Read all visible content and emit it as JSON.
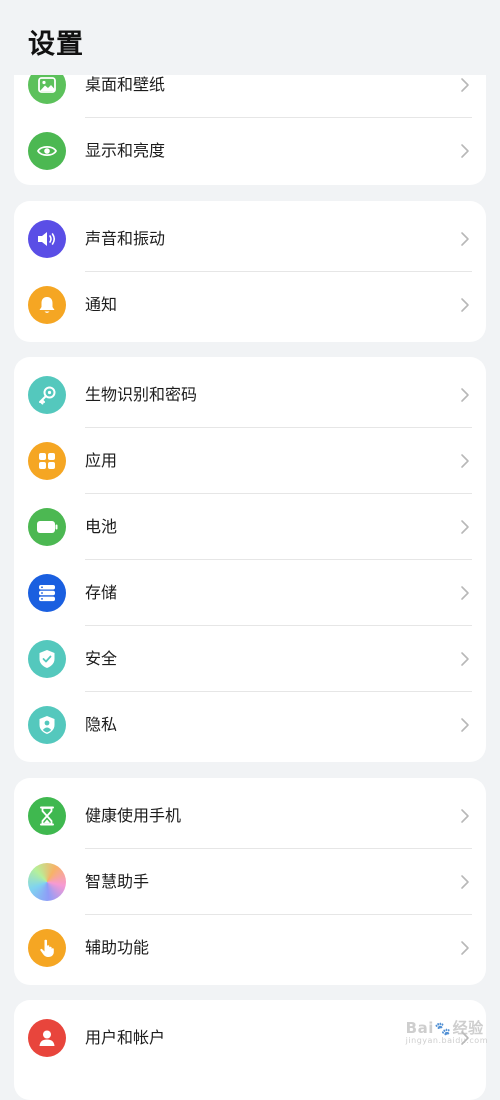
{
  "header": {
    "title": "设置",
    "status_fragment": "·· ··"
  },
  "cards": [
    {
      "items": [
        {
          "label": "桌面和壁纸",
          "icon": "wallpaper-icon",
          "color": "#5cc15b"
        },
        {
          "label": "显示和亮度",
          "icon": "eye-icon",
          "color": "#4cb852"
        }
      ]
    },
    {
      "items": [
        {
          "label": "声音和振动",
          "icon": "speaker-icon",
          "color": "#5a4ee6"
        },
        {
          "label": "通知",
          "icon": "bell-icon",
          "color": "#f5a623"
        }
      ]
    },
    {
      "items": [
        {
          "label": "生物识别和密码",
          "icon": "key-icon",
          "color": "#54c8bd"
        },
        {
          "label": "应用",
          "icon": "apps-icon",
          "color": "#f5a623"
        },
        {
          "label": "电池",
          "icon": "battery-icon",
          "color": "#4cb852"
        },
        {
          "label": "存储",
          "icon": "storage-icon",
          "color": "#1a5fe0"
        },
        {
          "label": "安全",
          "icon": "shield-check-icon",
          "color": "#54c8bd"
        },
        {
          "label": "隐私",
          "icon": "privacy-shield-icon",
          "color": "#54c8bd"
        }
      ]
    },
    {
      "items": [
        {
          "label": "健康使用手机",
          "icon": "hourglass-icon",
          "color": "#3fb84f"
        },
        {
          "label": "智慧助手",
          "icon": "assistant-orb-icon",
          "color": "#c88ad8"
        },
        {
          "label": "辅助功能",
          "icon": "hand-pointer-icon",
          "color": "#f5a623"
        }
      ]
    },
    {
      "items": [
        {
          "label": "用户和帐户",
          "icon": "user-icon",
          "color": "#e8453c"
        }
      ]
    }
  ],
  "watermark": {
    "text_left": "Bai",
    "text_right": "经验",
    "sub": "jingyan.baidu.com"
  }
}
